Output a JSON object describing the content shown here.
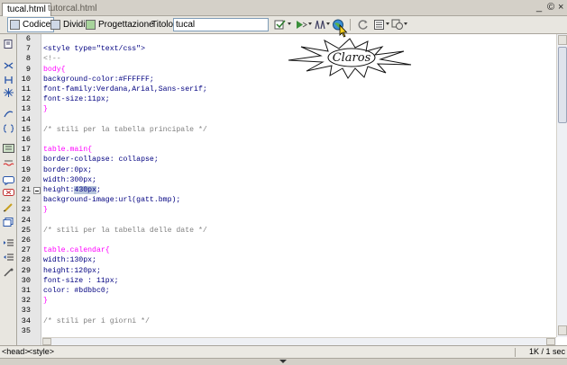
{
  "tabs": [
    {
      "label": "tucal.html",
      "active": true
    },
    {
      "label": "tutorcal.html",
      "active": false
    }
  ],
  "window_controls": {
    "minimize": "_",
    "restore": "©",
    "close": "×"
  },
  "toolbar": {
    "code_label": "Codice",
    "split_label": "Dividi",
    "design_label": "Progettazione",
    "title_label": "Titolo:",
    "title_value": "tucal"
  },
  "logo_text": "Claros",
  "gutter": {
    "line_numbers": [
      "6",
      "7",
      "8",
      "9",
      "10",
      "11",
      "12",
      "13",
      "14",
      "15",
      "16",
      "17",
      "18",
      "19",
      "20",
      "21",
      "22",
      "23",
      "24",
      "25",
      "26",
      "27",
      "28",
      "29",
      "30",
      "31",
      "32",
      "33",
      "34",
      "35"
    ]
  },
  "code_lines": [
    "",
    "<style type=\"text/css\">",
    "<!--",
    "body{",
    "background-color:#FFFFFF;",
    "font-family:Verdana,Arial,Sans-serif;",
    "font-size:11px;",
    "}",
    "",
    "/* stili per la tabella principale */",
    "",
    "table.main{",
    "border-collapse: collapse;",
    "border:0px;",
    "width:300px;",
    "height:430px;",
    "background-image:url(gatt.bmp);",
    "}",
    "",
    "/* stili per la tabella delle date */",
    "",
    "table.calendar{",
    "width:130px;",
    "height:120px;",
    "font-size : 11px;",
    "color: #bdbbc0;",
    "}",
    "",
    "/* stili per i giorni */",
    ""
  ],
  "status": {
    "tags": [
      "<head>",
      "<style>"
    ],
    "info": "1K / 1 sec"
  }
}
